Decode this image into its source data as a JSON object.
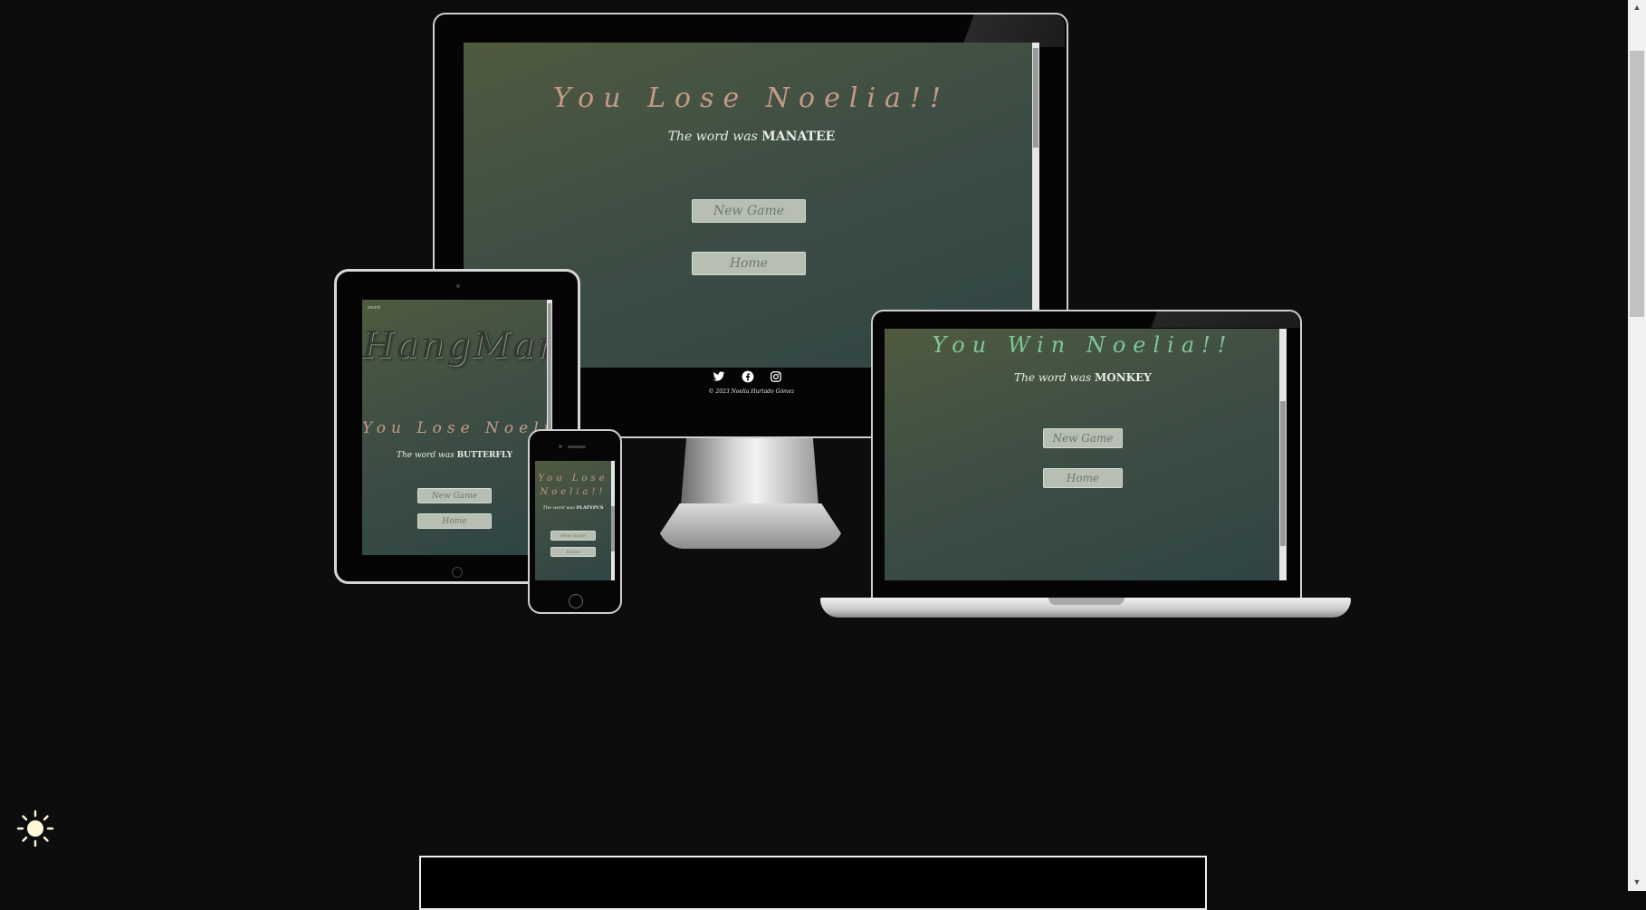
{
  "monitor": {
    "title": "You Lose Noelia!!",
    "word_prefix": "The word was",
    "word": "MANATEE",
    "new_game_label": "New Game",
    "home_label": "Home",
    "footer_text": "© 2023 Noelia Hurtado Gómez",
    "icons": [
      "twitter-icon",
      "facebook-icon",
      "instagram-icon"
    ]
  },
  "tablet": {
    "corner_text": "sound",
    "heading": "HangMan",
    "title": "You Lose Noelia!!",
    "word_prefix": "The word was",
    "word": "BUTTERFLY",
    "new_game_label": "New Game",
    "home_label": "Home"
  },
  "phone": {
    "title_line1": "You Lose",
    "title_line2": "Noelia!!",
    "word_prefix": "The word was",
    "word": "PLATYPUS",
    "new_game_label": "New Game",
    "home_label": "Home"
  },
  "laptop": {
    "title": "You Win Noelia!!",
    "word_prefix": "The word was",
    "word": "MONKEY",
    "new_game_label": "New Game",
    "home_label": "Home"
  },
  "colors": {
    "page_bg": "#0d0d0e",
    "lose_title": "#c49a86",
    "win_title": "#7fc596",
    "button_bg": "#b6bfb2"
  },
  "theme_toggle_icon": "sun-icon"
}
